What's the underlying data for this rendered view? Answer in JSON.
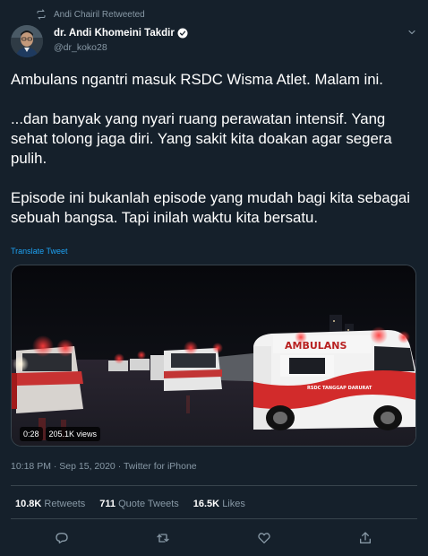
{
  "retweet": {
    "label": "Andi Chairil Retweeted",
    "icon": "retweet-icon"
  },
  "author": {
    "display_name": "dr. Andi Khomeini Takdir",
    "handle": "@dr_koko28",
    "verified_icon": "verified-badge-icon",
    "avatar_icon": "avatar"
  },
  "tweet": {
    "paragraphs": [
      "Ambulans ngantri masuk RSDC Wisma Atlet. Malam ini.",
      "...dan banyak yang nyari ruang perawatan intensif. Yang sehat tolong jaga diri. Yang sakit kita doakan agar segera pulih.",
      "Episode ini bukanlah episode yang mudah bagi kita sebagai sebuah bangsa. Tapi inilah waktu kita bersatu."
    ],
    "translate_label": "Translate Tweet"
  },
  "media": {
    "duration": "0:28",
    "views": "205.1K views",
    "ambulance_text": "AMBULANS",
    "side_text": "RSDC TANGGAP DARURAT"
  },
  "meta": {
    "time": "10:18 PM",
    "separator_1": "·",
    "date": "Sep 15, 2020",
    "separator_2": "·",
    "source": "Twitter for iPhone"
  },
  "stats": {
    "retweets_count": "10.8K",
    "retweets_label": "Retweets",
    "quotes_count": "711",
    "quotes_label": "Quote Tweets",
    "likes_count": "16.5K",
    "likes_label": "Likes"
  },
  "actions": [
    "reply-icon",
    "retweet-icon",
    "like-icon",
    "share-icon"
  ],
  "colors": {
    "background": "#15202b",
    "secondary_text": "#8899a6",
    "accent": "#1da1f2",
    "divider": "#38444d"
  }
}
